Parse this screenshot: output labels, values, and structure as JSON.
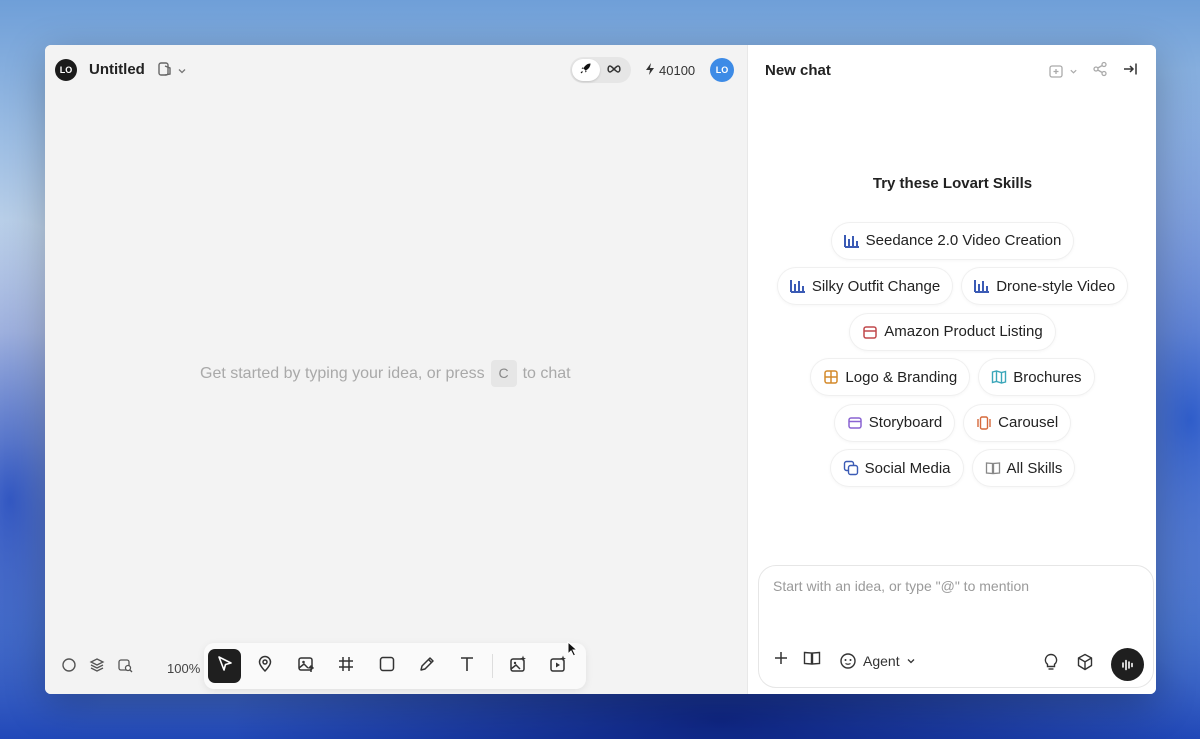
{
  "canvas": {
    "doc_title": "Untitled",
    "credits": "40100",
    "avatar_initials": "LO",
    "hint_before": "Get started by typing your idea, or press",
    "hint_key": "C",
    "hint_after": "to chat",
    "zoom": "100%",
    "tools": [
      {
        "name": "select-tool",
        "icon": "cursor-arrow-icon",
        "active": true
      },
      {
        "name": "mark-tool",
        "icon": "map-pin-icon"
      },
      {
        "name": "upload-image-tool",
        "icon": "image-upload-icon"
      },
      {
        "name": "frame-tool",
        "icon": "hash-icon"
      },
      {
        "name": "shape-tool",
        "icon": "square-icon"
      },
      {
        "name": "pen-tool",
        "icon": "pencil-icon"
      },
      {
        "name": "text-tool",
        "icon": "text-t-icon"
      },
      {
        "name": "image-generator-tool",
        "icon": "image-sparkle-icon"
      },
      {
        "name": "video-generator-tool",
        "icon": "video-sparkle-icon"
      }
    ]
  },
  "chat": {
    "title": "New chat",
    "skills_title": "Try these Lovart Skills",
    "skills": [
      [
        "Seedance 2.0 Video Creation"
      ],
      [
        "Silky Outfit Change",
        "Drone-style Video"
      ],
      [
        "Amazon Product Listing"
      ],
      [
        "Logo & Branding",
        "Brochures"
      ],
      [
        "Storyboard",
        "Carousel"
      ],
      [
        "Social Media",
        "All Skills"
      ]
    ],
    "composer_placeholder": "Start with an idea, or type \"@\" to mention",
    "agent_label": "Agent"
  },
  "colors": {
    "accent_blue": "#3d8be6",
    "chart_icon": "#3b5bb5",
    "amazon_icon": "#c0484c",
    "logo_icon": "#d48a2c",
    "brochure_icon": "#3aa6b9",
    "storyboard_icon": "#8a63d2",
    "carousel_icon": "#d66a3c"
  }
}
